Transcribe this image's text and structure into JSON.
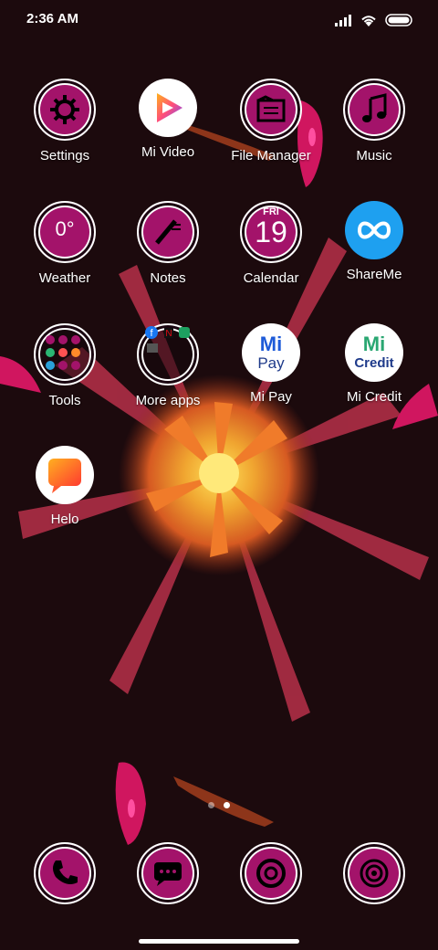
{
  "status": {
    "time": "2:36 AM"
  },
  "apps": [
    {
      "name": "Settings",
      "label": "Settings"
    },
    {
      "name": "Mi Video",
      "label": "Mi Video"
    },
    {
      "name": "File Manager",
      "label": "File Manager"
    },
    {
      "name": "Music",
      "label": "Music"
    },
    {
      "name": "Weather",
      "label": "Weather",
      "temperature": "0°"
    },
    {
      "name": "Notes",
      "label": "Notes"
    },
    {
      "name": "Calendar",
      "label": "Calendar",
      "day": "FRI",
      "date": "19"
    },
    {
      "name": "ShareMe",
      "label": "ShareMe"
    },
    {
      "name": "Tools",
      "label": "Tools"
    },
    {
      "name": "More apps",
      "label": "More apps"
    },
    {
      "name": "Mi Pay",
      "label": "Mi Pay",
      "logo_top": "Mi",
      "logo_bottom": "Pay"
    },
    {
      "name": "Mi Credit",
      "label": "Mi Credit",
      "logo_top": "Mi",
      "logo_bottom": "Credit"
    },
    {
      "name": "Helo",
      "label": "Helo"
    }
  ],
  "dock": [
    {
      "name": "phone",
      "icon": "phone-icon"
    },
    {
      "name": "messages",
      "icon": "messages-icon"
    },
    {
      "name": "browser",
      "icon": "browser-icon"
    },
    {
      "name": "camera",
      "icon": "camera-icon"
    }
  ],
  "pages": {
    "count": 2,
    "active_index": 1
  },
  "colors": {
    "accent_pink": "#a3136a",
    "background": "#1c0a0d",
    "mi_green": "#2aa772",
    "mi_blue": "#1e5bd8",
    "share_blue": "#1ea0f0"
  }
}
